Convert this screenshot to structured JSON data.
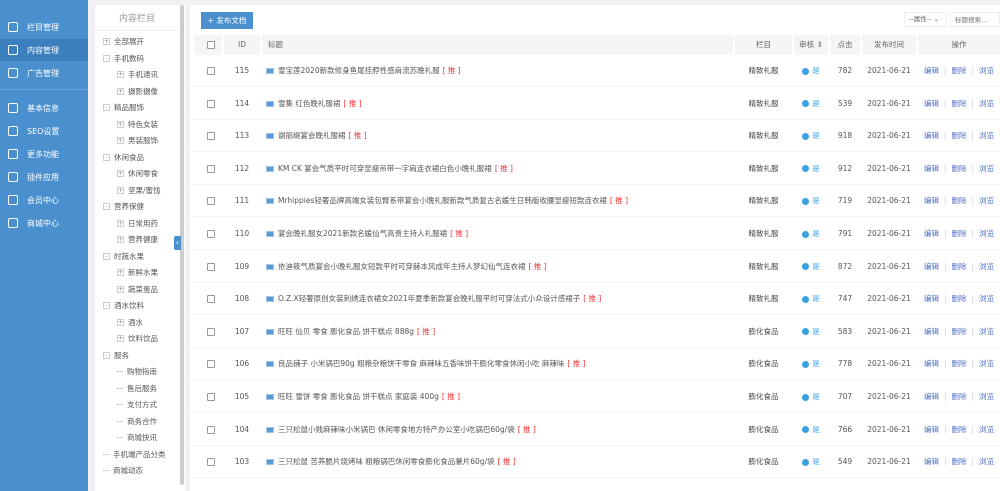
{
  "nav": {
    "items": [
      {
        "label": "栏目管理",
        "icon": "layers-icon"
      },
      {
        "label": "内容管理",
        "icon": "document-icon",
        "active": true
      },
      {
        "label": "广告管理",
        "icon": "ad-icon"
      },
      {
        "label": "基本信息",
        "icon": "gear-icon"
      },
      {
        "label": "SEO设置",
        "icon": "seo-icon"
      },
      {
        "label": "更多功能",
        "icon": "grid-icon"
      },
      {
        "label": "插件应用",
        "icon": "plugin-icon"
      },
      {
        "label": "会员中心",
        "icon": "user-icon"
      },
      {
        "label": "商城中心",
        "icon": "cart-icon"
      }
    ]
  },
  "tree": {
    "title": "内容栏目",
    "nodes": [
      {
        "label": "全部展开",
        "level": 0,
        "mark": "+"
      },
      {
        "label": "手机数码",
        "level": 0,
        "mark": "-"
      },
      {
        "label": "手机通讯",
        "level": 1,
        "mark": "+"
      },
      {
        "label": "摄影摄像",
        "level": 1,
        "mark": "+"
      },
      {
        "label": "精品服饰",
        "level": 0,
        "mark": "-"
      },
      {
        "label": "特色女装",
        "level": 1,
        "mark": "+"
      },
      {
        "label": "男装服饰",
        "level": 1,
        "mark": "+"
      },
      {
        "label": "休闲食品",
        "level": 0,
        "mark": "-"
      },
      {
        "label": "休闲零食",
        "level": 1,
        "mark": "+"
      },
      {
        "label": "坚果/蜜饯",
        "level": 1,
        "mark": "+"
      },
      {
        "label": "营养保健",
        "level": 0,
        "mark": "-"
      },
      {
        "label": "日常用药",
        "level": 1,
        "mark": "+"
      },
      {
        "label": "营养健康",
        "level": 1,
        "mark": "+"
      },
      {
        "label": "时蔬水果",
        "level": 0,
        "mark": "-"
      },
      {
        "label": "新鲜水果",
        "level": 1,
        "mark": "+"
      },
      {
        "label": "蔬菜蛋品",
        "level": 1,
        "mark": "+"
      },
      {
        "label": "酒水饮料",
        "level": 0,
        "mark": "-"
      },
      {
        "label": "酒水",
        "level": 1,
        "mark": "+"
      },
      {
        "label": "饮料饮品",
        "level": 1,
        "mark": "+"
      },
      {
        "label": "服务",
        "level": 0,
        "mark": "-"
      },
      {
        "label": "购物指南",
        "level": 1,
        "mark": ""
      },
      {
        "label": "售后服务",
        "level": 1,
        "mark": ""
      },
      {
        "label": "支付方式",
        "level": 1,
        "mark": ""
      },
      {
        "label": "商务合作",
        "level": 1,
        "mark": ""
      },
      {
        "label": "商城快讯",
        "level": 1,
        "mark": ""
      },
      {
        "label": "手机端产品分类",
        "level": 0,
        "mark": ""
      },
      {
        "label": "商城动态",
        "level": 0,
        "mark": ""
      }
    ]
  },
  "toolbar": {
    "add_label": "+ 发布文档",
    "attr_select": "--属性--",
    "search_placeholder": "标题搜索..."
  },
  "table": {
    "headers": {
      "id": "ID",
      "title": "标题",
      "category": "栏目",
      "audit": "审核",
      "clicks": "点击",
      "date": "发布时间",
      "ops": "操作"
    },
    "tag": "[ 推 ]",
    "audit_yes": "是",
    "ops": [
      "编辑",
      "删除",
      "浏览"
    ],
    "rows": [
      {
        "id": "115",
        "title": "雪宝莲2020新款修身鱼尾挂脖性感肩流苏晚礼服",
        "category": "精致礼服",
        "clicks": "782",
        "date": "2021-06-21"
      },
      {
        "id": "114",
        "title": "雪集 红色晚礼服裙",
        "category": "精致礼服",
        "clicks": "539",
        "date": "2021-06-21"
      },
      {
        "id": "113",
        "title": "谢丽缇宴会晚礼服裙",
        "category": "精致礼服",
        "clicks": "918",
        "date": "2021-06-21"
      },
      {
        "id": "112",
        "title": "KM CK 宴会气质平时可穿显瘦吊带一字肩连衣裙白色小晚礼服裙",
        "category": "精致礼服",
        "clicks": "912",
        "date": "2021-06-21"
      },
      {
        "id": "111",
        "title": "Mrhippies轻奢品牌高端女装包臂系带宴会小晚礼服新款气质复古名媛生日韩版收腰显瘦短款连衣裙",
        "category": "精致礼服",
        "clicks": "719",
        "date": "2021-06-21"
      },
      {
        "id": "110",
        "title": "宴会晚礼服女2021新款名媛仙气高贵主持人礼服裙",
        "category": "精致礼服",
        "clicks": "791",
        "date": "2021-06-21"
      },
      {
        "id": "109",
        "title": "依迪筱气质宴会小晚礼服女短款平时可穿赫本风成年主持人梦幻仙气连衣裙",
        "category": "精致礼服",
        "clicks": "872",
        "date": "2021-06-21"
      },
      {
        "id": "108",
        "title": "O.Z.X轻奢原创女装刺绣连衣裙女2021年夏季新款宴会晚礼服平时可穿法式小众设计感裙子",
        "category": "精致礼服",
        "clicks": "747",
        "date": "2021-06-21"
      },
      {
        "id": "107",
        "title": "旺旺 仙贝 零食 膨化食品 饼干糕点 888g",
        "category": "膨化食品",
        "clicks": "583",
        "date": "2021-06-21"
      },
      {
        "id": "106",
        "title": "良品铺子 小米锅巴90g 粗粮杂粮饼干零食 麻辣味五香味饼干膨化零食休闲小吃 麻辣味",
        "category": "膨化食品",
        "clicks": "778",
        "date": "2021-06-21"
      },
      {
        "id": "105",
        "title": "旺旺 雪饼 零食 膨化食品 饼干糕点 家庭装 400g",
        "category": "膨化食品",
        "clicks": "707",
        "date": "2021-06-21"
      },
      {
        "id": "104",
        "title": "三只松鼠小贱麻辣味小米锅巴 休闲零食地方特产办公室小吃锅巴60g/袋",
        "category": "膨化食品",
        "clicks": "766",
        "date": "2021-06-21"
      },
      {
        "id": "103",
        "title": "三只松鼠 苦荞脆片烧烤味 粗粮锅巴休闲零食膨化食品薯片60g/袋",
        "category": "膨化食品",
        "clicks": "549",
        "date": "2021-06-21"
      }
    ]
  }
}
